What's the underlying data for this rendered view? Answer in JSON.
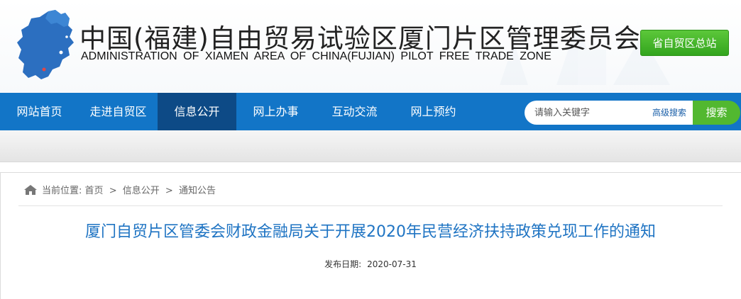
{
  "header": {
    "title_cn": "中国(福建)自由贸易试验区厦门片区管理委员会",
    "title_en": "ADMINISTRATION OF XIAMEN AREA OF CHINA(FUJIAN) PILOT FREE TRADE ZONE",
    "logo_icon": "fujian-map-icon",
    "province_button": "省自贸区总站"
  },
  "nav": {
    "items": [
      {
        "label": "网站首页"
      },
      {
        "label": "走进自贸区"
      },
      {
        "label": "信息公开",
        "active": true
      },
      {
        "label": "网上办事"
      },
      {
        "label": "互动交流"
      },
      {
        "label": "网上预约"
      }
    ],
    "search": {
      "placeholder": "请输入关键字",
      "advanced": "高级搜索",
      "button": "搜索"
    }
  },
  "breadcrumb": {
    "icon": "home-icon",
    "prefix": "当前位置:",
    "items": [
      "首页",
      "信息公开",
      "通知公告"
    ],
    "separator": ">"
  },
  "article": {
    "title": "厦门自贸片区管委会财政金融局关于开展2020年民营经济扶持政策兑现工作的通知",
    "date_label": "发布日期:",
    "date": "2020-07-31"
  },
  "colors": {
    "nav_bg": "#1275c7",
    "nav_active": "#0d4a86",
    "accent_green": "#52b830",
    "title_blue": "#1f74c3"
  }
}
